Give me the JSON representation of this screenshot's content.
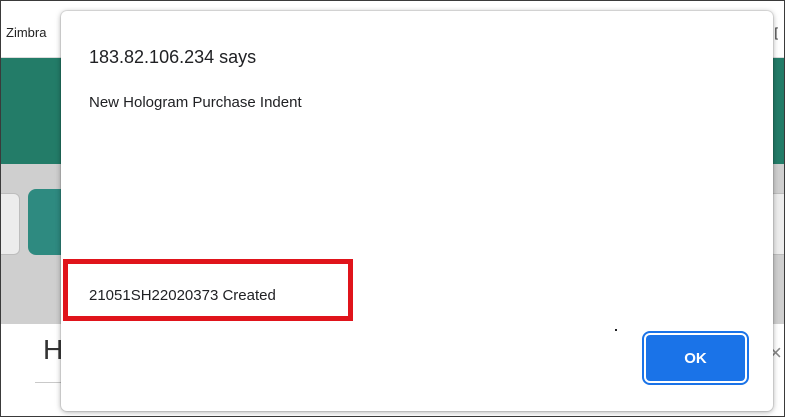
{
  "browser": {
    "bookmark_left": "Zimbra",
    "bookmark_right": "[",
    "header_color": "#237c68",
    "toolbar_color": "#cfcfcf",
    "edit_button_color": "#2e8a80",
    "edit_icon": "pencil-icon"
  },
  "page": {
    "heading": "H",
    "close_glyph": "×"
  },
  "dialog": {
    "origin": "183.82.106.234 says",
    "message": "New Hologram Purchase Indent",
    "created_message": "21051SH22020373 Created",
    "dot": ".",
    "ok_label": "OK",
    "ok_color": "#1a73e8",
    "highlight_color": "#e0141b"
  }
}
